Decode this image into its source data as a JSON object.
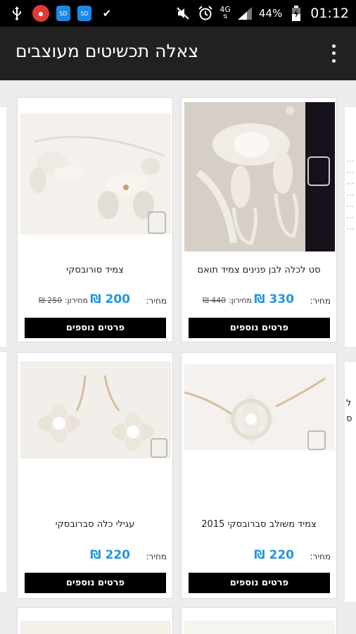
{
  "status_bar": {
    "battery_percent": "44%",
    "network": "4G",
    "time": "01:12",
    "icons": [
      "usb-icon",
      "app-notification-icon",
      "sd-card-icon",
      "sd-card-icon",
      "check-icon",
      "mute-icon",
      "alarm-icon",
      "signal-icon",
      "battery-icon"
    ]
  },
  "app_bar": {
    "title": "צאלה תכשיטים מעוצבים",
    "menu_icon": "more-vertical-icon"
  },
  "products": [
    {
      "name": "סט לכלה לבן פנינים צמיד תואם",
      "price_label": "מחיר:",
      "price": "330 ₪",
      "old_price_label": "מחירון:",
      "old_price": "440 ₪",
      "button": "פרטים נוספים"
    },
    {
      "name": "צמיד סורובסקי",
      "price_label": "מחיר:",
      "price": "200 ₪",
      "old_price_label": "מחירון:",
      "old_price": "250 ₪",
      "button": "פרטים נוספים"
    },
    {
      "name": "צמיד משולב סברובסקי 2015",
      "price_label": "מחיר:",
      "price": "220 ₪",
      "button": "פרטים נוספים"
    },
    {
      "name": "עגילי כלה סברובסקי",
      "price_label": "מחיר:",
      "price": "220 ₪",
      "button": "פרטים נוספים"
    }
  ],
  "side_fragment": {
    "text": "ל ס"
  },
  "colors": {
    "app_bar": "#212121",
    "price": "#2196d9",
    "button": "#000000"
  }
}
